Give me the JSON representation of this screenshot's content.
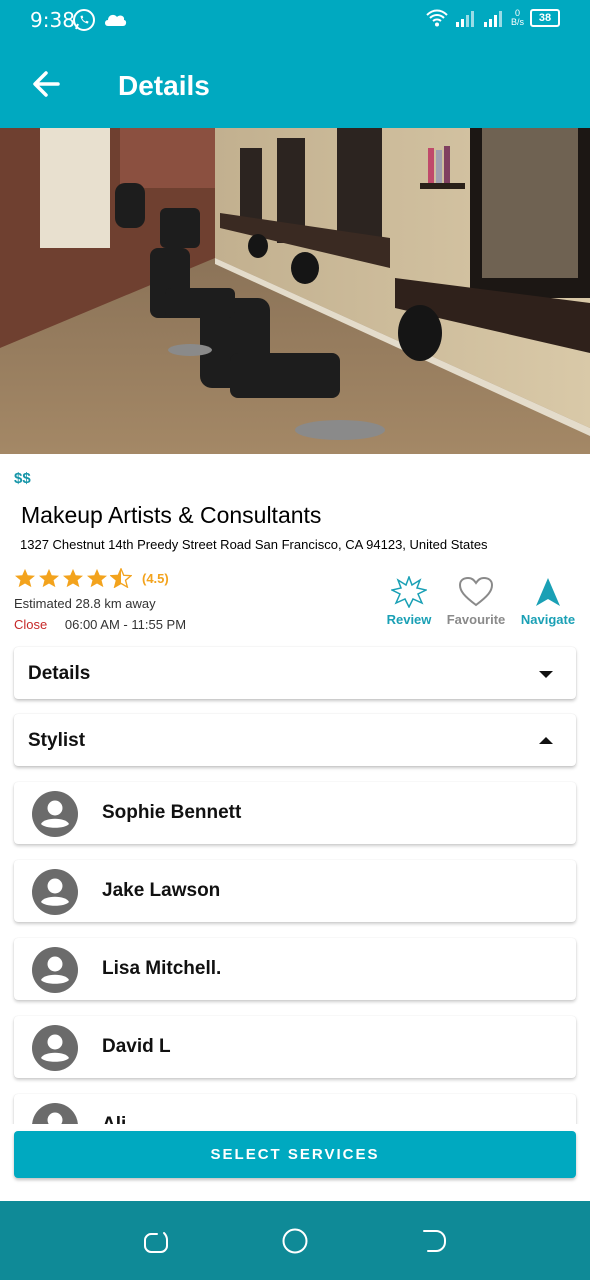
{
  "status_bar": {
    "time": "9:38",
    "net_speed_value": "0",
    "net_speed_unit": "B/s",
    "battery": "38"
  },
  "app_bar": {
    "title": "Details"
  },
  "salon": {
    "price_level": "$$",
    "name": "Makeup Artists & Consultants",
    "address": "1327 Chestnut 14th Preedy Street Road  San Francisco, CA  94123, United States",
    "rating_value": 4.5,
    "rating_text": "(4.5)",
    "distance": "Estimated 28.8 km away",
    "status": "Close",
    "hours": "06:00 AM - 11:55 PM"
  },
  "actions": {
    "review": "Review",
    "favourite": "Favourite",
    "navigate": "Navigate"
  },
  "sections": {
    "details_title": "Details",
    "stylist_title": "Stylist"
  },
  "stylists": [
    {
      "name": "Sophie Bennett"
    },
    {
      "name": "Jake Lawson"
    },
    {
      "name": "Lisa Mitchell."
    },
    {
      "name": "David L"
    },
    {
      "name": "Ali"
    }
  ],
  "select_services_label": "SELECT SERVICES",
  "colors": {
    "primary": "#00a9c0",
    "nav_bar": "#0f8a97",
    "star": "#f3a31d",
    "close_status": "#c62828",
    "price": "#1595a8"
  }
}
